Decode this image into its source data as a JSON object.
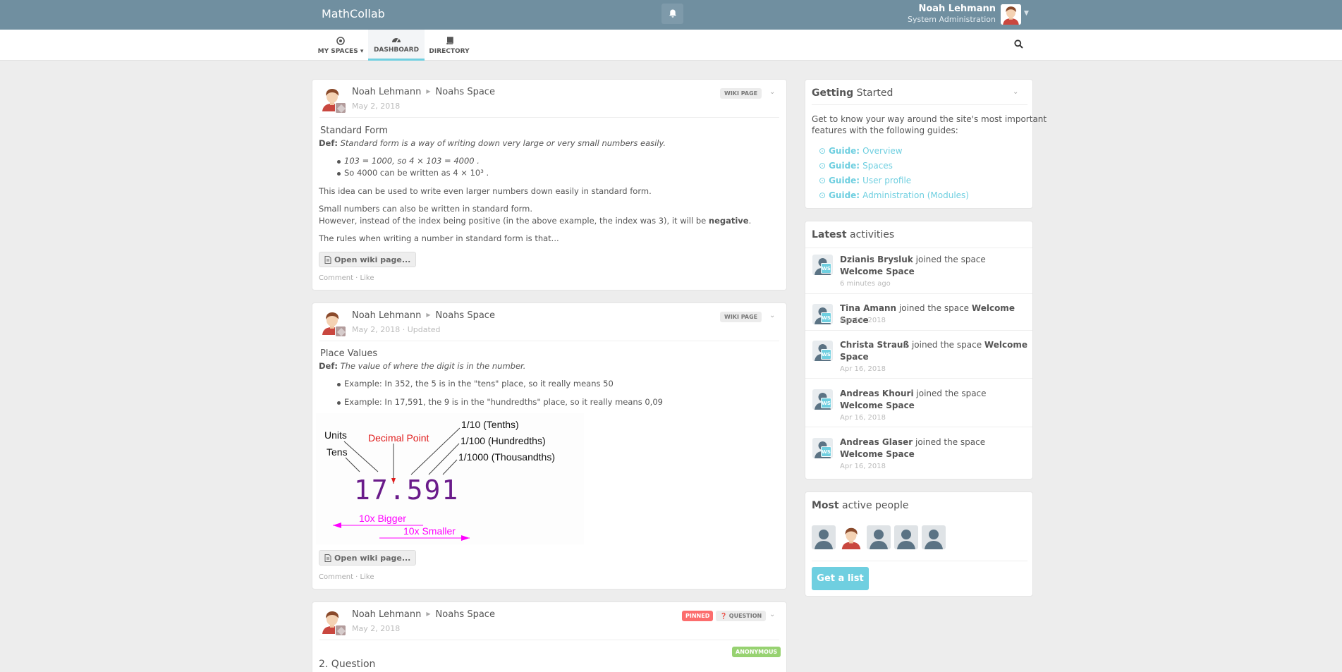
{
  "app": {
    "title": "MathCollab"
  },
  "user": {
    "name": "Noah Lehmann",
    "role": "System Administration"
  },
  "nav": {
    "my_spaces": "MY SPACES",
    "dashboard": "DASHBOARD",
    "directory": "DIRECTORY"
  },
  "posts": [
    {
      "author": "Noah Lehmann",
      "space": "Noahs Space",
      "date": "May 2, 2018",
      "label": "WIKI PAGE",
      "title": "Standard Form",
      "def_label": "Def:",
      "def_text": "Standard form is a way of writing down very large or very small numbers easily.",
      "bullets": [
        "103 = 1000, so 4 × 103 = 4000 .",
        "So 4000 can be written as 4 × 10³ ."
      ],
      "p1": "This idea can be used to write even larger numbers down easily in standard form.",
      "p2a": "Small numbers can also be written in standard form.",
      "p2b": "However, instead of the index being positive (in the above example, the index was 3), it will be",
      "p2b_bold": "negative",
      "p2b_end": ".",
      "p3": "The rules when writing a number in standard form is that...",
      "open_btn": "Open wiki page...",
      "comment": "Comment",
      "like": "Like"
    },
    {
      "author": "Noah Lehmann",
      "space": "Noahs Space",
      "date": "May 2, 2018 · Updated",
      "label": "WIKI PAGE",
      "title": "Place Values",
      "def_label": "Def:",
      "def_text": "The value of where the digit is in the number.",
      "bullets": [
        "Example: In 352, the 5 is in the \"tens\" place, so it really means 50",
        "Example: In 17,591, the 9 is in the \"hundredths\" place, so it really means 0,09"
      ],
      "diagram": {
        "units": "Units",
        "tens": "Tens",
        "decimal_point": "Decimal Point",
        "tenths": "1/10 (Tenths)",
        "hundredths": "1/100 (Hundredths)",
        "thousandths": "1/1000 (Thousandths)",
        "number": "17.591",
        "bigger": "10x Bigger",
        "smaller": "10x Smaller"
      },
      "open_btn": "Open wiki page...",
      "comment": "Comment",
      "like": "Like"
    },
    {
      "author": "Noah Lehmann",
      "space": "Noahs Space",
      "date": "May 2, 2018",
      "pinned": "PINNED",
      "label": "QUESTION",
      "anonymous": "ANONYMOUS",
      "title": "2. Question"
    }
  ],
  "getting_started": {
    "title_bold": "Getting",
    "title_rest": "Started",
    "intro1": "Get to know your way around the site's most important",
    "intro2": "features with the following guides:",
    "guides": [
      {
        "prefix": "Guide:",
        "label": "Overview"
      },
      {
        "prefix": "Guide:",
        "label": "Spaces"
      },
      {
        "prefix": "Guide:",
        "label": "User profile"
      },
      {
        "prefix": "Guide:",
        "label": "Administration (Modules)"
      }
    ]
  },
  "activities": {
    "title_bold": "Latest",
    "title_rest": "activities",
    "items": [
      {
        "user": "Dzianis Brysluk",
        "text": "joined the space",
        "space": "Welcome Space",
        "date": "6 minutes ago"
      },
      {
        "user": "Tina Amann",
        "text": "joined the space",
        "space": "Welcome Space",
        "date": "Apr 19, 2018"
      },
      {
        "user": "Christa Strauß",
        "text": "joined the space",
        "space": "Welcome Space",
        "date": "Apr 16, 2018"
      },
      {
        "user": "Andreas Khouri",
        "text": "joined the space",
        "space": "Welcome Space",
        "date": "Apr 16, 2018"
      },
      {
        "user": "Andreas Glaser",
        "text": "joined the space",
        "space": "Welcome Space",
        "date": "Apr 16, 2018"
      }
    ],
    "ws_badge": "WS"
  },
  "active_people": {
    "title_bold": "Most",
    "title_rest": "active people",
    "button": "Get a list"
  }
}
